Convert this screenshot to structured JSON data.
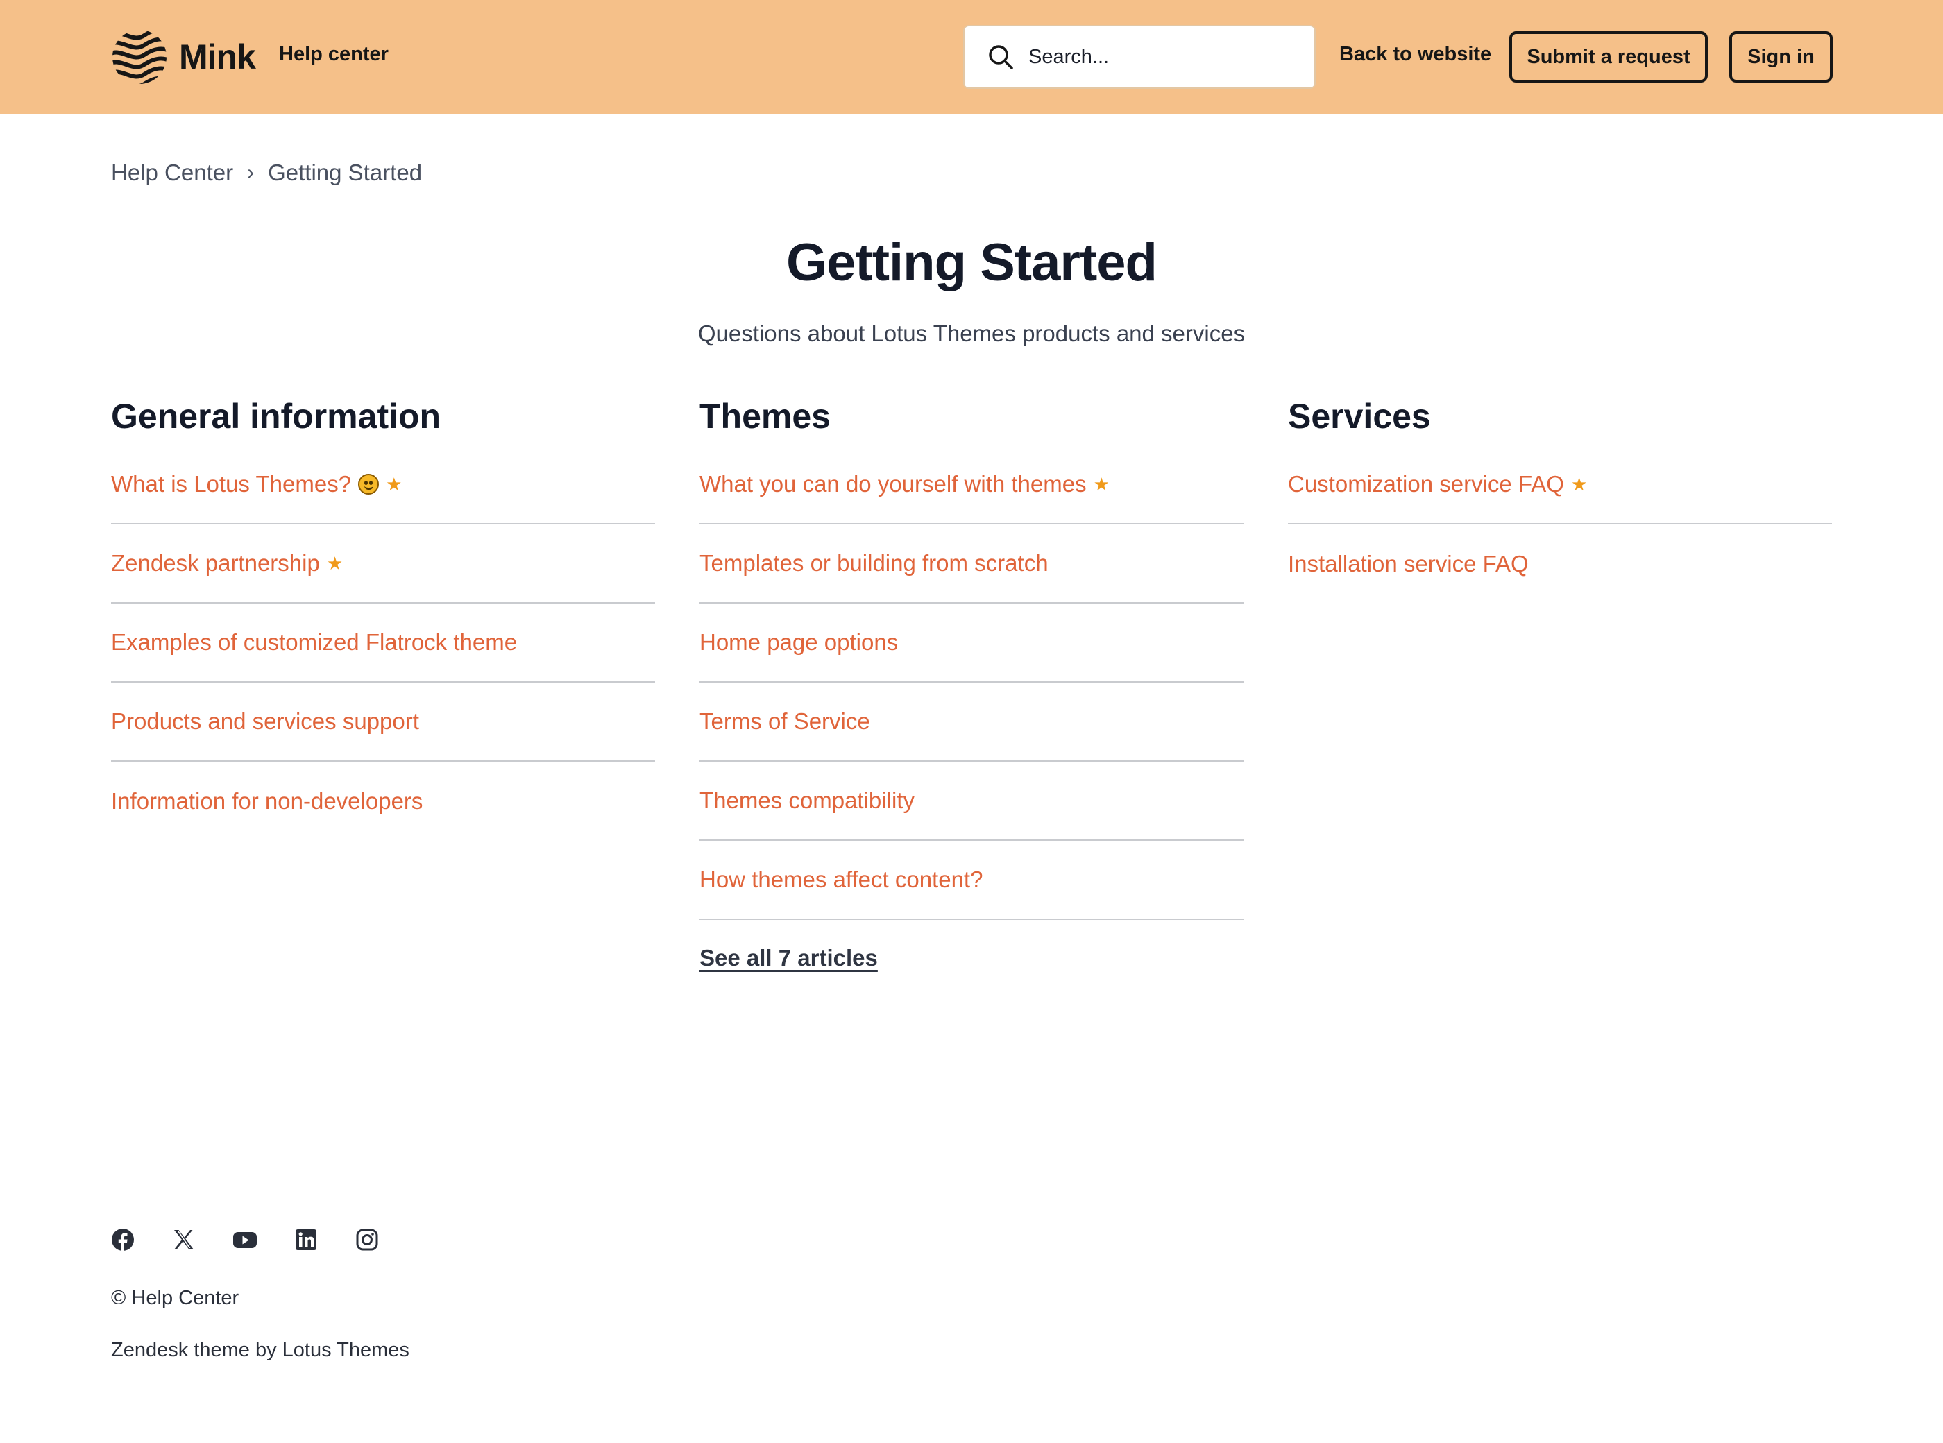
{
  "header": {
    "brand": "Mink",
    "help_center_label": "Help center",
    "search_placeholder": "Search...",
    "back_link": "Back to website",
    "submit_request": "Submit a request",
    "sign_in": "Sign in",
    "bg_color": "#f5c089"
  },
  "breadcrumb": {
    "items": [
      "Help Center",
      "Getting Started"
    ],
    "separator": "›"
  },
  "page": {
    "title": "Getting Started",
    "subtitle": "Questions about Lotus Themes products and services"
  },
  "sections": [
    {
      "title": "General information",
      "articles": [
        {
          "label": "What is Lotus Themes?",
          "emoji": "smiling-face-icon",
          "promoted": true
        },
        {
          "label": "Zendesk partnership",
          "promoted": true
        },
        {
          "label": "Examples of customized Flatrock theme",
          "promoted": false
        },
        {
          "label": "Products and services support",
          "promoted": false
        },
        {
          "label": "Information for non-developers",
          "promoted": false
        }
      ]
    },
    {
      "title": "Themes",
      "articles": [
        {
          "label": "What you can do yourself with themes",
          "promoted": true
        },
        {
          "label": "Templates or building from scratch",
          "promoted": false
        },
        {
          "label": "Home page options",
          "promoted": false
        },
        {
          "label": "Terms of Service",
          "promoted": false
        },
        {
          "label": "Themes compatibility",
          "promoted": false
        },
        {
          "label": "How themes affect content?",
          "promoted": false
        }
      ],
      "see_all": "See all 7 articles"
    },
    {
      "title": "Services",
      "articles": [
        {
          "label": "Customization service FAQ",
          "promoted": true
        },
        {
          "label": "Installation service FAQ",
          "promoted": false
        }
      ]
    }
  ],
  "footer": {
    "socials": [
      "facebook-icon",
      "x-icon",
      "youtube-icon",
      "linkedin-icon",
      "instagram-icon"
    ],
    "copyright": "© Help Center",
    "credit": "Zendesk theme by Lotus Themes"
  },
  "colors": {
    "link": "#e0643a",
    "star": "#f09a1a",
    "heading": "#141a29"
  },
  "star_glyph": "★"
}
